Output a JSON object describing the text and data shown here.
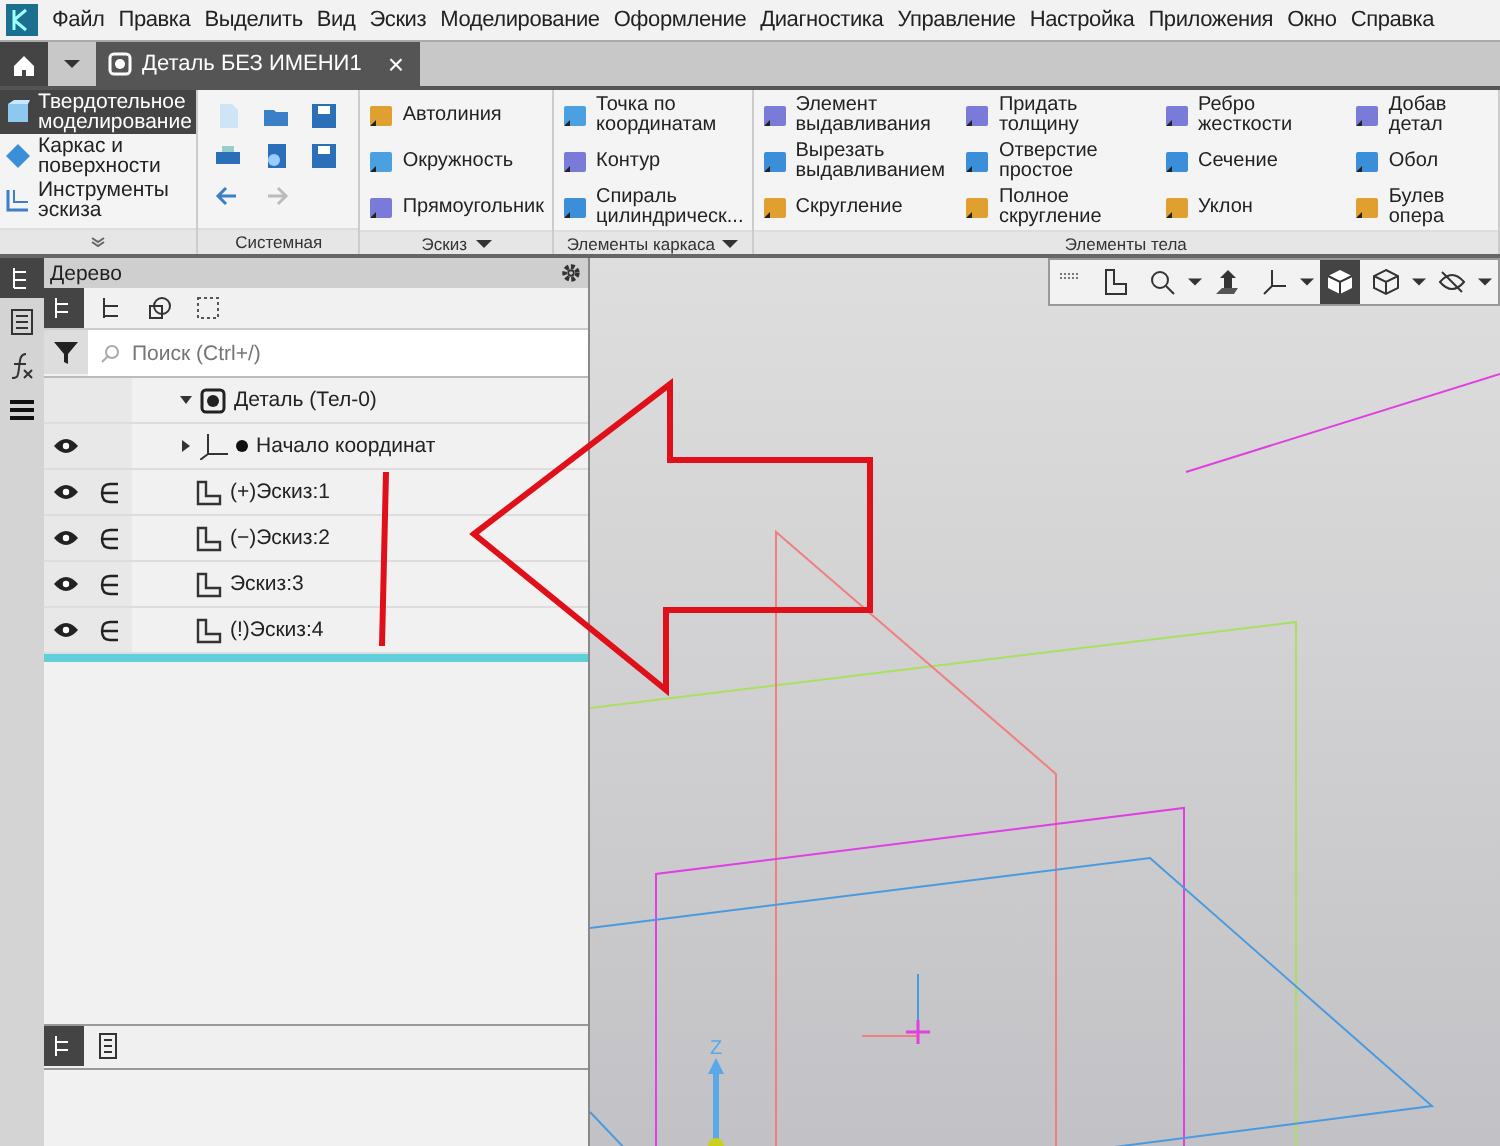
{
  "menu": [
    "Файл",
    "Правка",
    "Выделить",
    "Вид",
    "Эскиз",
    "Моделирование",
    "Оформление",
    "Диагностика",
    "Управление",
    "Настройка",
    "Приложения",
    "Окно",
    "Справка"
  ],
  "document_tab": {
    "title": "Деталь БЕЗ ИМЕНИ1",
    "close": "×"
  },
  "modes": [
    {
      "label": "Твердотельное моделирование",
      "selected": true
    },
    {
      "label": "Каркас и поверхности",
      "selected": false
    },
    {
      "label": "Инструменты эскиза",
      "selected": false
    }
  ],
  "ribbon_groups": [
    {
      "title": "Системная",
      "kind": "icons"
    },
    {
      "title": "Эскиз",
      "kind": "tools",
      "items": [
        "Автолиния",
        "Окружность",
        "Прямоугольник"
      ]
    },
    {
      "title": "Элементы каркаса",
      "kind": "tools",
      "items": [
        "Точка по координатам",
        "Контур",
        "Спираль цилиндрическ..."
      ]
    },
    {
      "title": "Элементы тела",
      "kind": "tools",
      "items": [
        "Элемент выдавливания",
        "Вырезать выдавливанием",
        "Скругление",
        "Придать толщину",
        "Отверстие простое",
        "Полное скругление",
        "Ребро жесткости",
        "Сечение",
        "Уклон",
        "Добав детал",
        "Обол",
        "Булев опера"
      ]
    }
  ],
  "tree_panel": {
    "title": "Дерево",
    "search": {
      "placeholder": "Поиск (Ctrl+/)"
    },
    "rows": [
      {
        "label": "Деталь (Тел-0)",
        "kind": "part",
        "eye": false,
        "constraint": false,
        "expanded": true
      },
      {
        "label": "Начало координат",
        "kind": "origin",
        "eye": true,
        "constraint": false,
        "expanded": false
      },
      {
        "label": "(+)Эскиз:1",
        "kind": "sketch",
        "eye": true,
        "constraint": true
      },
      {
        "label": "(−)Эскиз:2",
        "kind": "sketch",
        "eye": true,
        "constraint": true
      },
      {
        "label": "Эскиз:3",
        "kind": "sketch",
        "eye": true,
        "constraint": true
      },
      {
        "label": "(!)Эскиз:4",
        "kind": "sketch",
        "eye": true,
        "constraint": true
      }
    ]
  },
  "viewport": {
    "axis_label": "Z"
  }
}
